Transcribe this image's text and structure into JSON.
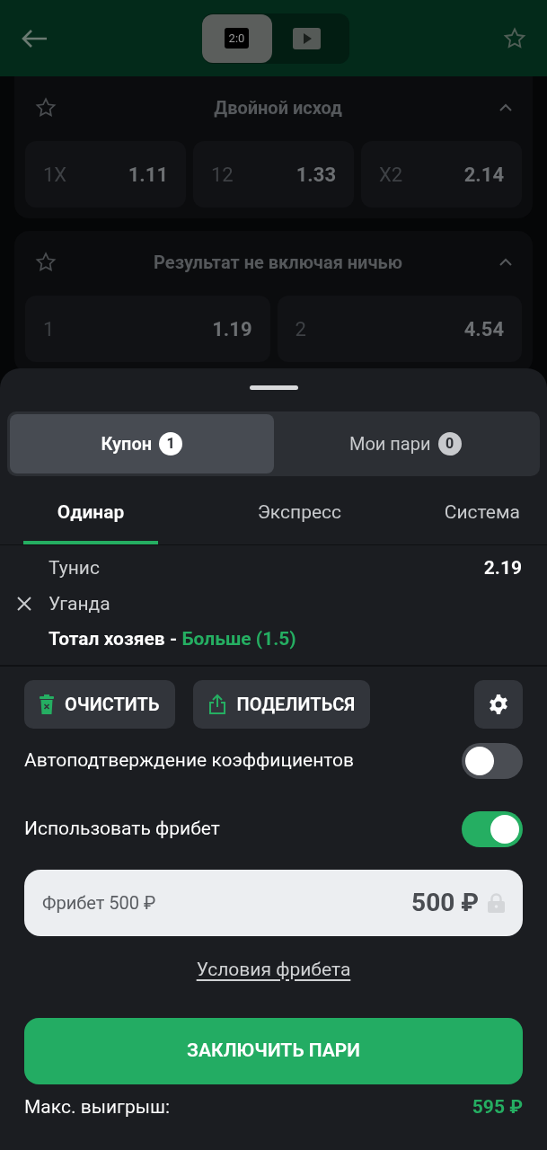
{
  "header": {
    "score": "2:0",
    "modes": [
      {
        "kind": "score",
        "selected": true
      },
      {
        "kind": "video",
        "selected": false
      }
    ]
  },
  "markets": [
    {
      "title": "Двойной исход",
      "expanded": true,
      "odds": [
        {
          "label": "1X",
          "value": "1.11"
        },
        {
          "label": "12",
          "value": "1.33"
        },
        {
          "label": "X2",
          "value": "2.14"
        }
      ]
    },
    {
      "title": "Результат не включая ничью",
      "expanded": true,
      "odds": [
        {
          "label": "1",
          "value": "1.19"
        },
        {
          "label": "2",
          "value": "4.54"
        }
      ]
    }
  ],
  "coupon_tabs": [
    {
      "label": "Купон",
      "count": "1",
      "selected": true
    },
    {
      "label": "Мои пари",
      "count": "0",
      "selected": false
    }
  ],
  "bet_types": [
    {
      "label": "Одинар",
      "selected": true
    },
    {
      "label": "Экспресс",
      "selected": false
    },
    {
      "label": "Система",
      "selected": false
    }
  ],
  "bet": {
    "home": "Тунис",
    "away": "Уганда",
    "odds": "2.19",
    "market": "Тотал хозяев -",
    "outcome": "Больше (1.5)"
  },
  "actions": [
    {
      "kind": "clear",
      "label": "ОЧИСТИТЬ"
    },
    {
      "kind": "share",
      "label": "ПОДЕЛИТЬСЯ"
    }
  ],
  "settings": [
    {
      "label": "Автоподтверждение коэффициентов",
      "on": false
    },
    {
      "label": "Использовать фрибет",
      "on": true
    }
  ],
  "freebet_field": {
    "label": "Фрибет 500 ₽",
    "value": "500 ₽"
  },
  "freebet_terms": "Условия фрибета",
  "submit": "ЗАКЛЮЧИТЬ ПАРИ",
  "max_win": {
    "label": "Макс. выигрыш:",
    "value": "595 ₽"
  }
}
